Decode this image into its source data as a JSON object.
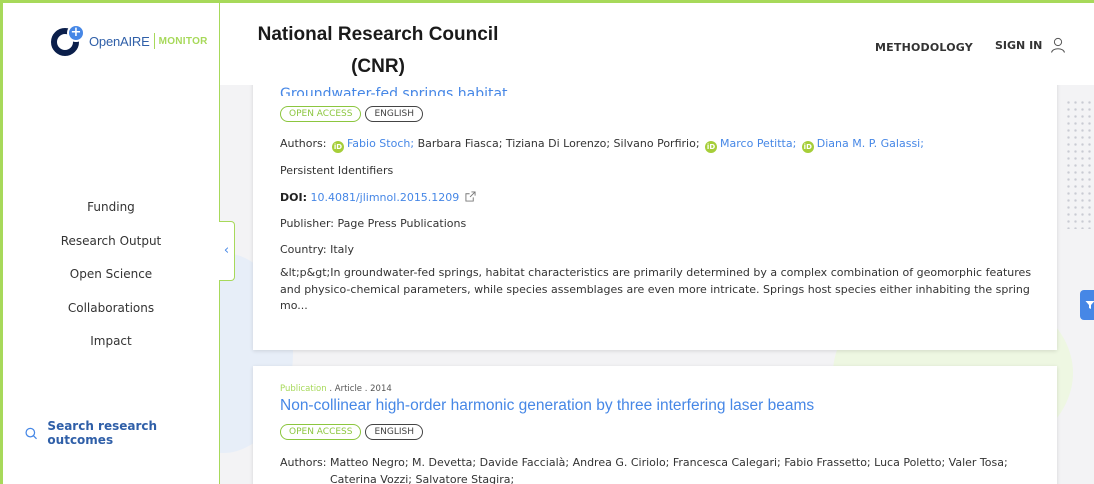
{
  "sidebar": {
    "logo": {
      "open": "Open",
      "aire": "AIRE",
      "monitor": "MONITOR"
    },
    "nav": [
      "Funding",
      "Research Output",
      "Open Science",
      "Collaborations",
      "Impact"
    ],
    "search_outcomes": "Search research outcomes"
  },
  "header": {
    "title_line1": "National Research Council",
    "title_line2": "(CNR)",
    "methodology": "METHODOLOGY",
    "signin": "SIGN IN"
  },
  "results": [
    {
      "partial_title": "Groundwater-fed springs habitat",
      "badges": {
        "access": "OPEN ACCESS",
        "language": "ENGLISH"
      },
      "authors_label": "Authors:",
      "authors": [
        "Fabio Stoch;",
        "Barbara Fiasca;",
        "Tiziana Di Lorenzo;",
        "Silvano Porfirio;",
        "Marco Petitta;",
        "Diana M. P. Galassi;"
      ],
      "persistent_ids": "Persistent Identifiers",
      "doi_label": "DOI:",
      "doi": "10.4081/jlimnol.2015.1209",
      "publisher_label": "Publisher:",
      "publisher": "Page Press Publications",
      "country_label": "Country:",
      "country": "Italy",
      "description": "&lt;p&gt;In groundwater-fed springs, habitat characteristics are primarily determined by a complex combination of geomorphic features and physico-chemical parameters, while species assemblages are even more intricate. Springs host species either inhabiting the spring mo..."
    },
    {
      "type": "Publication",
      "subtype": ". Article . 2014",
      "title": "Non-collinear high-order harmonic generation by three interfering laser beams",
      "badges": {
        "access": "OPEN ACCESS",
        "language": "ENGLISH"
      },
      "authors_label": "Authors:",
      "authors_line1": "Matteo Negro; M. Devetta; Davide Faccialà; Andrea G. Ciriolo; Francesca Calegari; Fabio Frassetto; Luca Poletto; Valer Tosa;",
      "authors_line2": "Caterina Vozzi; Salvatore Stagira;"
    }
  ],
  "colors": {
    "accent_green": "#a7d95a",
    "link_blue": "#4687e6",
    "navy": "#0b1f4b"
  }
}
